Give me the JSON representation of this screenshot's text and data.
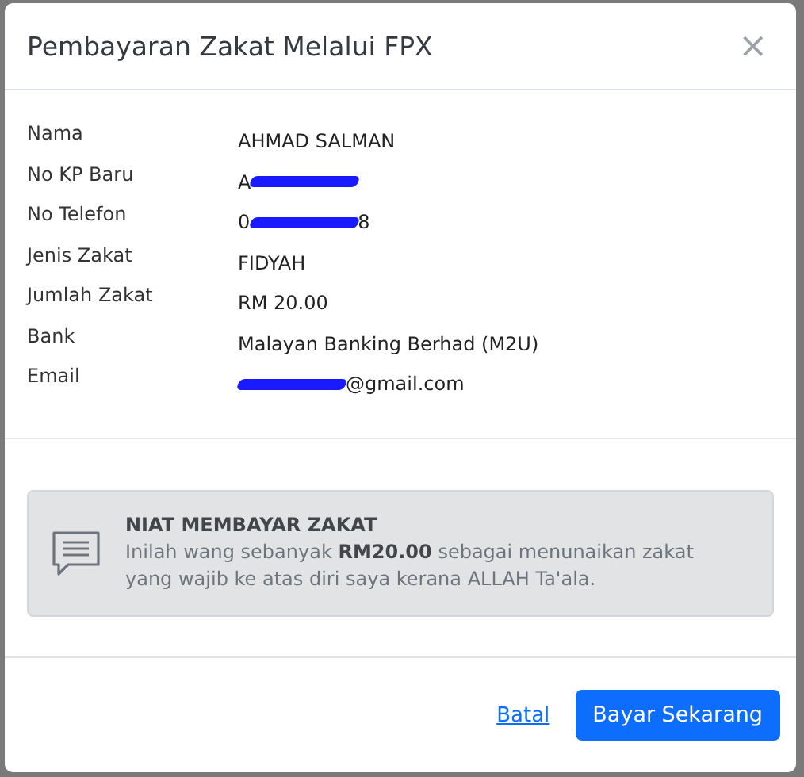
{
  "modal": {
    "title": "Pembayaran Zakat Melalui FPX",
    "close": "×"
  },
  "details": [
    {
      "label": "Nama",
      "value": "AHMAD SALMAN",
      "redacted": false
    },
    {
      "label": "No KP Baru",
      "before": "A",
      "redacted": true
    },
    {
      "label": "No Telefon",
      "before": "0",
      "after": "8",
      "redacted": true
    },
    {
      "label": "Jenis Zakat",
      "value": "FIDYAH",
      "redacted": false
    },
    {
      "label": "Jumlah Zakat",
      "value": "RM 20.00",
      "redacted": false
    },
    {
      "label": "Bank",
      "value": "Malayan Banking Berhad (M2U)",
      "redacted": false
    },
    {
      "label": "Email",
      "after": "@gmail.com",
      "redacted": true
    }
  ],
  "notice": {
    "title": "NIAT MEMBAYAR ZAKAT",
    "text": "Inilah wang sebanyak **RM20.00** sebagai menunaikan zakat yang wajib ke atas diri saya kerana ALLAH Ta'ala."
  },
  "buttons": [
    {
      "label": "Batal",
      "kind": "link"
    },
    {
      "label": "Bayar Sekarang",
      "kind": "primary"
    }
  ]
}
